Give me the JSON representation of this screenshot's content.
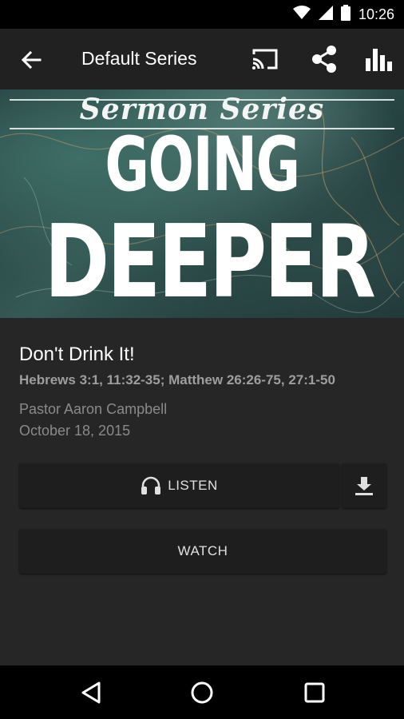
{
  "status_bar": {
    "time": "10:26",
    "icons": [
      "wifi-icon",
      "cellular-signal-icon",
      "battery-icon"
    ]
  },
  "app_bar": {
    "title": "Default Series",
    "actions": [
      "cast-icon",
      "share-icon",
      "stats-icon"
    ]
  },
  "hero": {
    "script_text": "Sermon Series",
    "line1": "GOING",
    "line2": "DEEPER"
  },
  "sermon": {
    "title": "Don't Drink It!",
    "scripture": "Hebrews 3:1, 11:32-35; Matthew 26:26-75, 27:1-50",
    "speaker": "Pastor Aaron Campbell",
    "date": "October 18, 2015"
  },
  "buttons": {
    "listen_label": "LISTEN",
    "watch_label": "WATCH"
  },
  "nav": {
    "items": [
      "back-triangle-icon",
      "home-circle-icon",
      "recents-square-icon"
    ]
  },
  "colors": {
    "app_bar": "#212121",
    "content_bg": "#262626",
    "button_bg": "#1e1e1e",
    "secondary_text": "#8a8a8a"
  }
}
